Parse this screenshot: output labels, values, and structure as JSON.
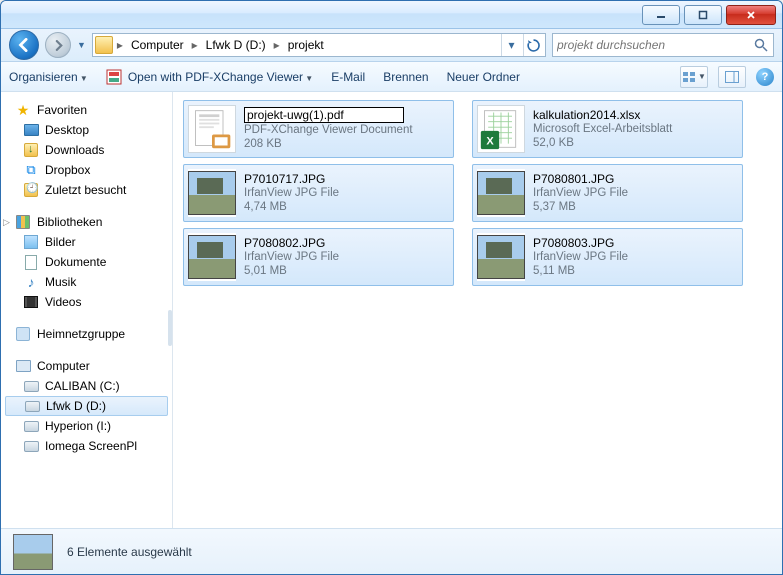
{
  "breadcrumb": {
    "root": "Computer",
    "drive": "Lfwk D (D:)",
    "folder": "projekt"
  },
  "search": {
    "placeholder": "projekt durchsuchen"
  },
  "toolbar": {
    "organize": "Organisieren",
    "open_with": "Open with PDF-XChange Viewer",
    "email": "E-Mail",
    "burn": "Brennen",
    "new_folder": "Neuer Ordner"
  },
  "sidebar": {
    "favorites": {
      "label": "Favoriten",
      "items": [
        "Desktop",
        "Downloads",
        "Dropbox",
        "Zuletzt besucht"
      ]
    },
    "libraries": {
      "label": "Bibliotheken",
      "items": [
        "Bilder",
        "Dokumente",
        "Musik",
        "Videos"
      ]
    },
    "homegroup": "Heimnetzgruppe",
    "computer": {
      "label": "Computer",
      "drives": [
        "CALIBAN (C:)",
        "Lfwk D (D:)",
        "Hyperion (I:)",
        "Iomega ScreenPl"
      ]
    }
  },
  "files": [
    {
      "name": "projekt-uwg(1).pdf",
      "type": "PDF-XChange Viewer Document",
      "size": "208 KB",
      "kind": "pdf",
      "editing": true
    },
    {
      "name": "kalkulation2014.xlsx",
      "type": "Microsoft Excel-Arbeitsblatt",
      "size": "52,0 KB",
      "kind": "xlsx"
    },
    {
      "name": "P7010717.JPG",
      "type": "IrfanView JPG File",
      "size": "4,74 MB",
      "kind": "jpg"
    },
    {
      "name": "P7080801.JPG",
      "type": "IrfanView JPG File",
      "size": "5,37 MB",
      "kind": "jpg"
    },
    {
      "name": "P7080802.JPG",
      "type": "IrfanView JPG File",
      "size": "5,01 MB",
      "kind": "jpg"
    },
    {
      "name": "P7080803.JPG",
      "type": "IrfanView JPG File",
      "size": "5,11 MB",
      "kind": "jpg"
    }
  ],
  "status": "6 Elemente ausgewählt"
}
